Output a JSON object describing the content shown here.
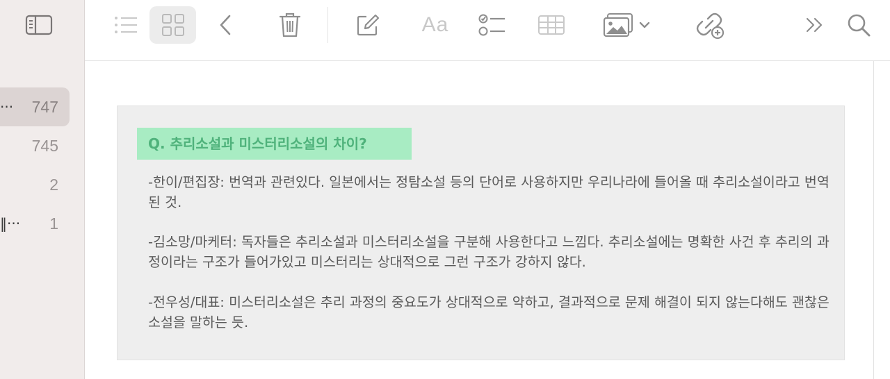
{
  "sidebar": {
    "folders": [
      {
        "prefix": "···",
        "count": "747",
        "selected": true
      },
      {
        "prefix": "",
        "count": "745",
        "selected": false
      },
      {
        "prefix": "",
        "count": "2",
        "selected": false
      },
      {
        "prefix": "‖···",
        "count": "1",
        "selected": false
      }
    ]
  },
  "toolbar": {
    "format_label": "Aa",
    "icons": [
      "sidebar-icon",
      "list-view-icon",
      "gallery-view-icon",
      "back-icon",
      "trash-icon",
      "compose-icon",
      "format-icon",
      "checklist-icon",
      "table-icon",
      "media-icon",
      "chevron-down-icon",
      "collaborate-icon",
      "more-icon",
      "search-icon"
    ]
  },
  "note": {
    "question": "Q. 추리소설과 미스터리소설의 차이?",
    "paragraphs": [
      "-한이/편집장: 번역과 관련있다. 일본에서는 정탐소설 등의 단어로 사용하지만 우리나라에 들어올 때 추리소설이라고 번역된 것.",
      "-김소망/마케터: 독자들은 추리소설과 미스터리소설을 구분해 사용한다고 느낌다. 추리소설에는 명확한 사건 후 추리의 과정이라는 구조가 들어가있고 미스터리는 상대적으로 그런 구조가 강하지 않다.",
      "-전우성/대표: 미스터리소설은 추리 과정의 중요도가 상대적으로 약하고, 결과적으로 문제 해결이 되지 않는다해도 괜찮은 소설을 말하는 듯."
    ]
  },
  "colors": {
    "highlight": "#a8ecc3",
    "question_text": "#4fb27b",
    "sidebar_bg": "#f1eceb",
    "icon_gray": "#8e8e8e"
  }
}
